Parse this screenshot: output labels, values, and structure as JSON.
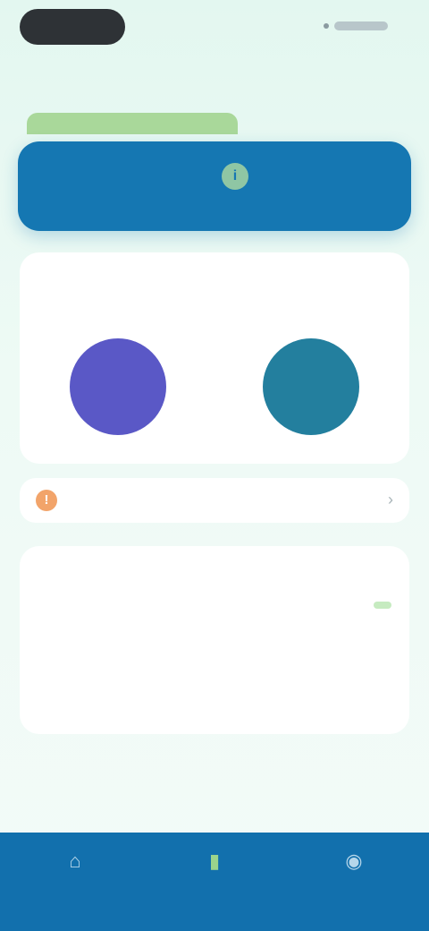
{
  "status_bar": {},
  "header": {
    "title": ""
  },
  "balance_card": {
    "label": "",
    "icon": "info-icon",
    "value": "",
    "sub": ""
  },
  "stats": [
    {
      "label": "",
      "sub": "",
      "value": ""
    },
    {
      "label": "",
      "sub": "",
      "value": ""
    }
  ],
  "alert": {
    "icon": "warning-icon",
    "glyph": "!",
    "text": "",
    "chevron": "›"
  },
  "info": {
    "title": "",
    "badge": "",
    "rows": [
      {
        "key": "",
        "value": ""
      },
      {
        "key": "",
        "value": ""
      }
    ]
  },
  "footer": {
    "text": ""
  },
  "nav": [
    {
      "icon": "home-icon",
      "glyph": "⌂",
      "label": ""
    },
    {
      "icon": "chart-icon",
      "glyph": "▮",
      "label": ""
    },
    {
      "icon": "profile-icon",
      "glyph": "◉",
      "label": ""
    }
  ],
  "colors": {
    "primary": "#1577b2",
    "accent_green": "#a9d89a",
    "stat_purple": "#5a58c6",
    "stat_teal": "#237f9e",
    "alert_orange": "#f2a46a"
  }
}
